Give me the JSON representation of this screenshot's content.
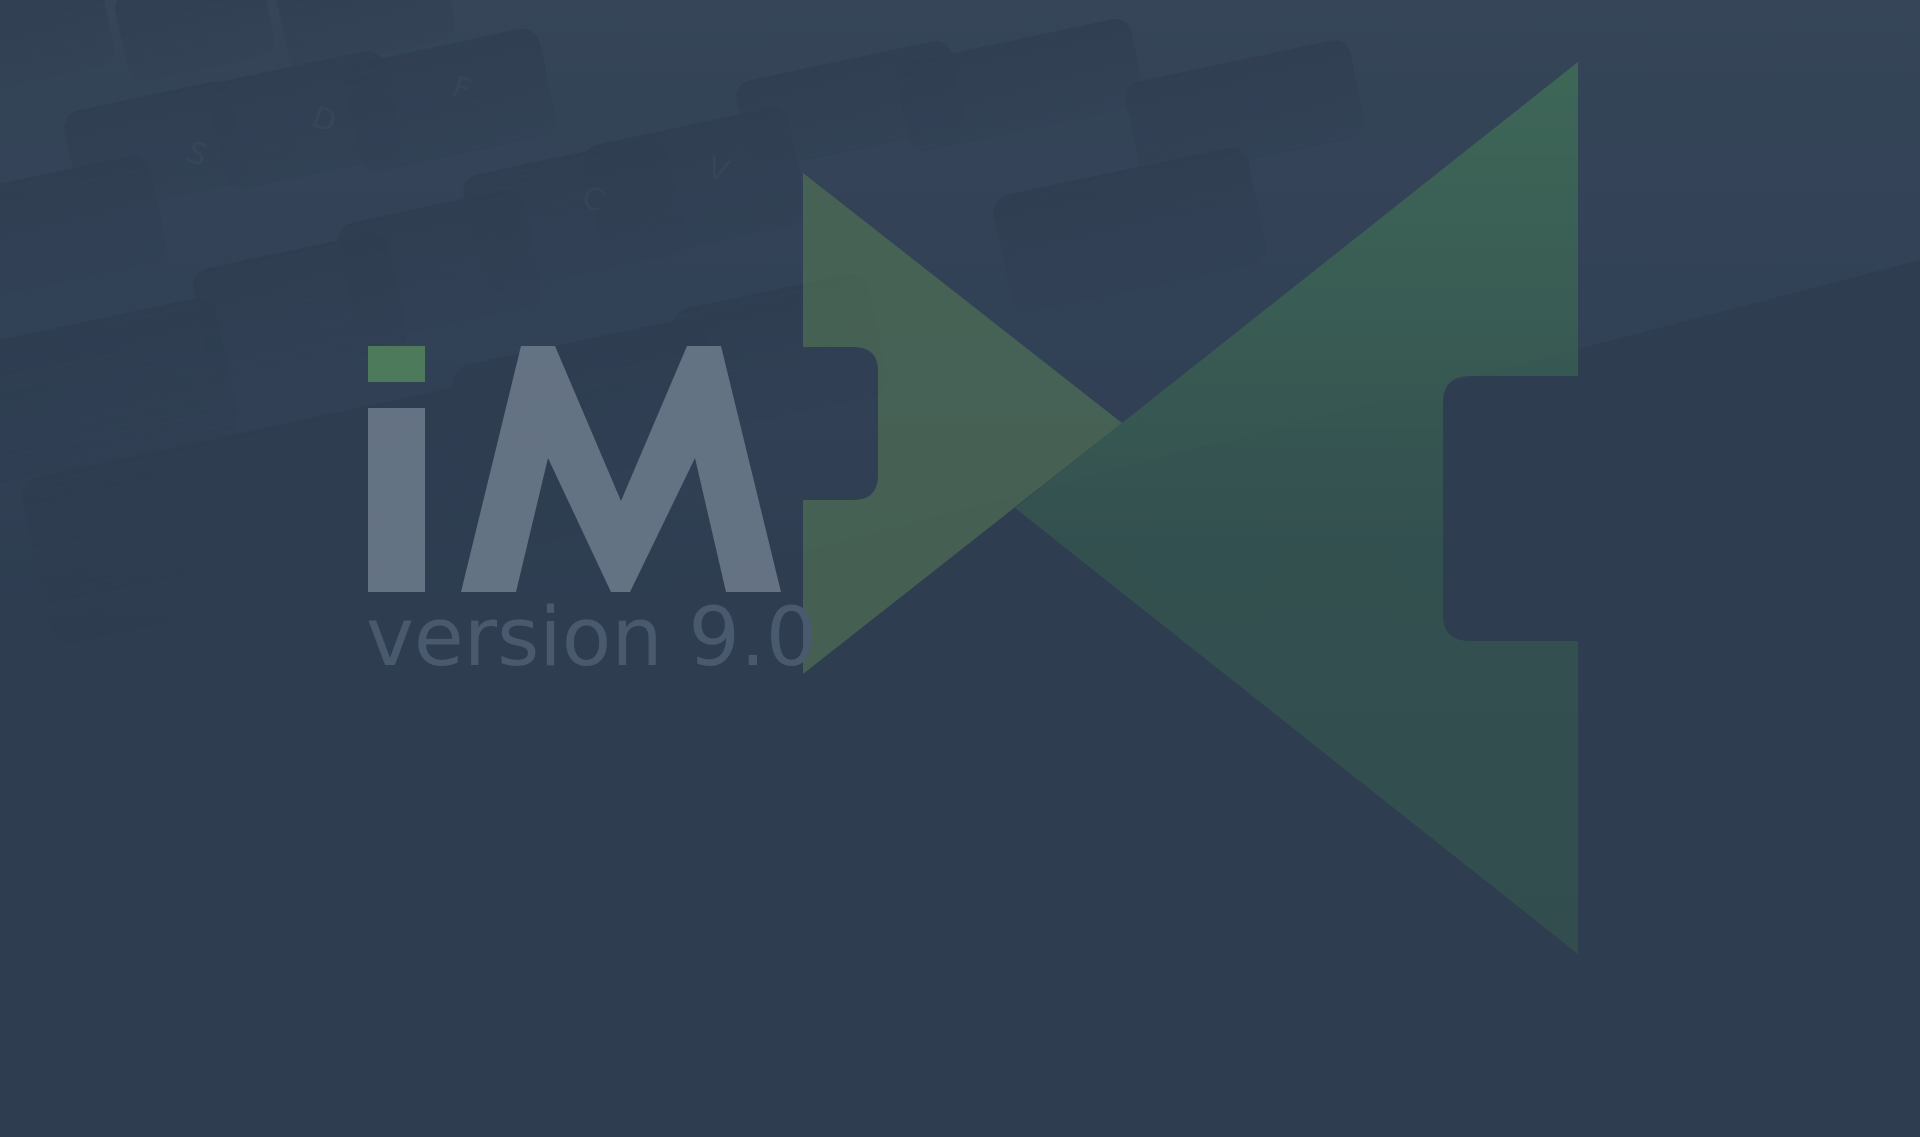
{
  "splash": {
    "brand": "iM",
    "version": "version 9.0"
  },
  "colors": {
    "background": "#2e3d50",
    "keyboard_background": "#374759",
    "accent_green": "#4d7a5b",
    "wordmark": "#6e7c8c",
    "version_text": "#4a5a6e"
  },
  "icons": {
    "background": "keyboard-photo",
    "logo": "bowtie-logo-icon"
  }
}
